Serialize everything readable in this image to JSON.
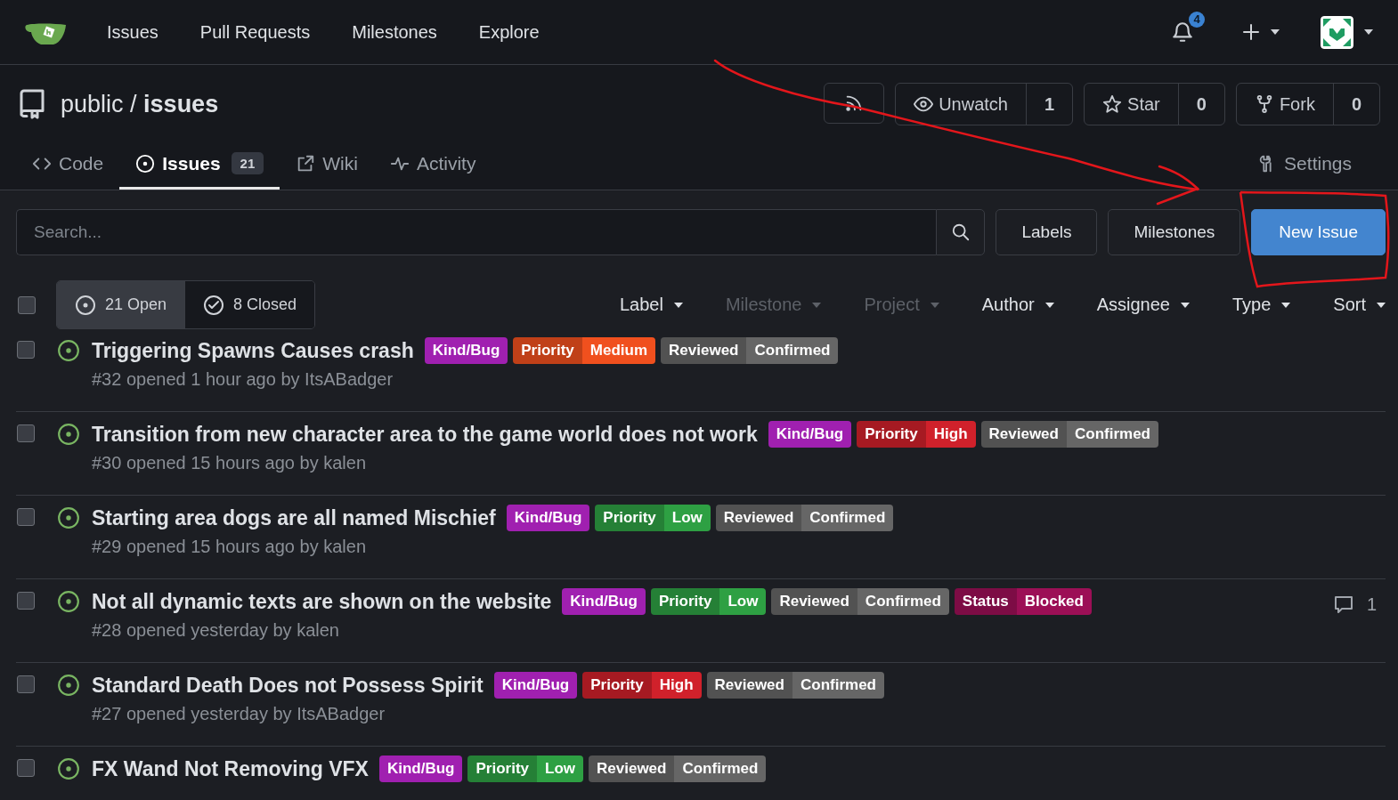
{
  "navbar": {
    "items": [
      "Issues",
      "Pull Requests",
      "Milestones",
      "Explore"
    ],
    "notifications": "4"
  },
  "repo": {
    "owner": "public",
    "separator": "/",
    "name": "issues",
    "actions": [
      {
        "kind": "rss"
      },
      {
        "kind": "watch",
        "label": "Unwatch",
        "count": "1"
      },
      {
        "kind": "star",
        "label": "Star",
        "count": "0"
      },
      {
        "kind": "fork",
        "label": "Fork",
        "count": "0"
      }
    ]
  },
  "tabs": [
    {
      "kind": "code",
      "label": "Code",
      "selected": false
    },
    {
      "kind": "issue",
      "label": "Issues",
      "count": "21",
      "selected": true
    },
    {
      "kind": "external",
      "label": "Wiki",
      "selected": false
    },
    {
      "kind": "pulse",
      "label": "Activity",
      "selected": false
    }
  ],
  "settings": "Settings",
  "search": {
    "placeholder": "Search..."
  },
  "buttons": [
    {
      "label": "Labels",
      "primary": false
    },
    {
      "label": "Milestones",
      "primary": false
    },
    {
      "label": "New Issue",
      "primary": true
    }
  ],
  "select_all": {
    "checked": false
  },
  "states": [
    {
      "kind": "open",
      "label": "21 Open",
      "selected": true
    },
    {
      "kind": "closed",
      "label": "8 Closed",
      "selected": false
    }
  ],
  "filters": [
    {
      "label": "Label",
      "disabled": false
    },
    {
      "label": "Milestone",
      "disabled": true
    },
    {
      "label": "Project",
      "disabled": true
    },
    {
      "label": "Author",
      "disabled": false
    },
    {
      "label": "Assignee",
      "disabled": false
    },
    {
      "label": "Type",
      "disabled": false
    },
    {
      "label": "Sort",
      "disabled": false
    }
  ],
  "issues": [
    {
      "title": "Triggering Spawns Causes crash",
      "checked": false,
      "meta": "#32 opened 1 hour ago by ItsABadger",
      "labels": [
        {
          "name": "Kind/Bug",
          "color": "#a020b0"
        },
        {
          "scope": "Priority",
          "name": "Medium",
          "color": "#f0501e"
        },
        {
          "scope": "Reviewed",
          "name": "Confirmed",
          "color": "#666666"
        }
      ]
    },
    {
      "title": "Transition from new character area to the game world does not work",
      "checked": false,
      "meta": "#30 opened 15 hours ago by kalen",
      "labels": [
        {
          "name": "Kind/Bug",
          "color": "#a020b0"
        },
        {
          "scope": "Priority",
          "name": "High",
          "color": "#d0212b"
        },
        {
          "scope": "Reviewed",
          "name": "Confirmed",
          "color": "#666666"
        }
      ]
    },
    {
      "title": "Starting area dogs are all named Mischief",
      "checked": false,
      "meta": "#29 opened 15 hours ago by kalen",
      "labels": [
        {
          "name": "Kind/Bug",
          "color": "#a020b0"
        },
        {
          "scope": "Priority",
          "name": "Low",
          "color": "#2ea043"
        },
        {
          "scope": "Reviewed",
          "name": "Confirmed",
          "color": "#666666"
        }
      ]
    },
    {
      "title": "Not all dynamic texts are shown on the website",
      "checked": false,
      "meta": "#28 opened yesterday by kalen",
      "comments": "1",
      "labels": [
        {
          "name": "Kind/Bug",
          "color": "#a020b0"
        },
        {
          "scope": "Priority",
          "name": "Low",
          "color": "#2ea043"
        },
        {
          "scope": "Reviewed",
          "name": "Confirmed",
          "color": "#666666"
        },
        {
          "scope": "Status",
          "name": "Blocked",
          "color": "#9c0f56"
        }
      ]
    },
    {
      "title": "Standard Death Does not Possess Spirit",
      "checked": false,
      "meta": "#27 opened yesterday by ItsABadger",
      "labels": [
        {
          "name": "Kind/Bug",
          "color": "#a020b0"
        },
        {
          "scope": "Priority",
          "name": "High",
          "color": "#d0212b"
        },
        {
          "scope": "Reviewed",
          "name": "Confirmed",
          "color": "#666666"
        }
      ]
    },
    {
      "title": "FX Wand Not Removing VFX",
      "checked": false,
      "labels": [
        {
          "name": "Kind/Bug",
          "color": "#a020b0"
        },
        {
          "scope": "Priority",
          "name": "Low",
          "color": "#2ea043"
        },
        {
          "scope": "Reviewed",
          "name": "Confirmed",
          "color": "#666666"
        }
      ]
    }
  ]
}
